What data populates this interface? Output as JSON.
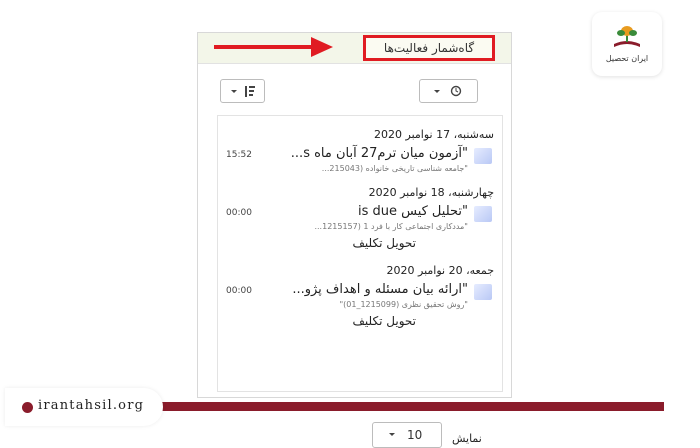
{
  "logo": {
    "brand": "ایران تحصیل"
  },
  "footer": {
    "site": "irantahsil.org"
  },
  "panel": {
    "header_title": "گاه‌شمار فعالیت‌ها",
    "list": [
      {
        "date": "سه‌شنبه، 17 نوامبر 2020",
        "title": "\"آزمون میان ترم27 آبان ماه s...",
        "subtitle": "\"جامعه شناسی تاریخی خانواده (215043...",
        "time": "15:52",
        "icon": "quiz-icon",
        "action": ""
      },
      {
        "date": "چهارشنبه، 18 نوامبر 2020",
        "title": "\"تحلیل کیس is due",
        "subtitle": "\"مددکاری اجتماعی کار با فرد 1 (1215157...",
        "time": "00:00",
        "icon": "assignment-icon",
        "action": "تحویل تکلیف"
      },
      {
        "date": "جمعه، 20 نوامبر 2020",
        "title": "\"ارائه بیان مسئله و اهداف پژو...",
        "subtitle": "\"روش تحقیق نظری (1215099_01)\"",
        "time": "00:00",
        "icon": "assignment-icon",
        "action": "تحویل تکلیف"
      }
    ],
    "show_label": "نمایش",
    "show_value": "10"
  },
  "colors": {
    "highlight": "#e01b22",
    "brand": "#8a1c2b"
  }
}
